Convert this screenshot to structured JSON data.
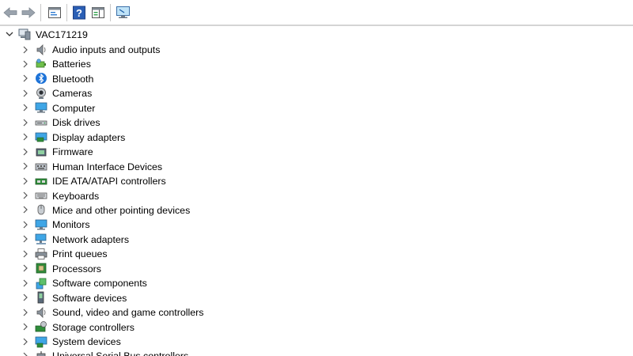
{
  "computer_name": "VAC171219",
  "categories": [
    {
      "label": "Audio inputs and outputs",
      "icon": "speaker-icon"
    },
    {
      "label": "Batteries",
      "icon": "battery-icon"
    },
    {
      "label": "Bluetooth",
      "icon": "bluetooth-icon"
    },
    {
      "label": "Cameras",
      "icon": "camera-icon"
    },
    {
      "label": "Computer",
      "icon": "computer-icon"
    },
    {
      "label": "Disk drives",
      "icon": "disk-drive-icon"
    },
    {
      "label": "Display adapters",
      "icon": "display-adapter-icon"
    },
    {
      "label": "Firmware",
      "icon": "firmware-icon"
    },
    {
      "label": "Human Interface Devices",
      "icon": "hid-icon"
    },
    {
      "label": "IDE ATA/ATAPI controllers",
      "icon": "ide-controller-icon"
    },
    {
      "label": "Keyboards",
      "icon": "keyboard-icon"
    },
    {
      "label": "Mice and other pointing devices",
      "icon": "mouse-icon"
    },
    {
      "label": "Monitors",
      "icon": "monitor-icon"
    },
    {
      "label": "Network adapters",
      "icon": "network-adapter-icon"
    },
    {
      "label": "Print queues",
      "icon": "printer-icon"
    },
    {
      "label": "Processors",
      "icon": "processor-icon"
    },
    {
      "label": "Software components",
      "icon": "software-component-icon"
    },
    {
      "label": "Software devices",
      "icon": "software-device-icon"
    },
    {
      "label": "Sound, video and game controllers",
      "icon": "sound-controller-icon"
    },
    {
      "label": "Storage controllers",
      "icon": "storage-controller-icon"
    },
    {
      "label": "System devices",
      "icon": "system-devices-icon"
    },
    {
      "label": "Universal Serial Bus controllers",
      "icon": "usb-controller-icon"
    }
  ],
  "toolbar_buttons": [
    "back-arrow-icon",
    "forward-arrow-icon",
    "properties-icon",
    "help-icon",
    "action-pane-icon",
    "scan-hardware-icon"
  ]
}
